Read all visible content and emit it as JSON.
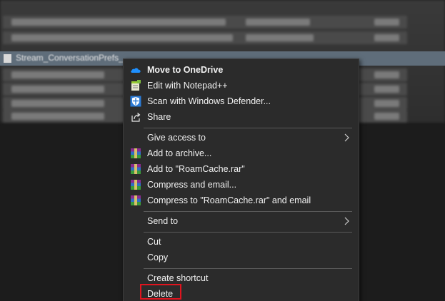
{
  "explorer": {
    "selected_file": "Stream_ConversationPrefs_..."
  },
  "context_menu": {
    "items": [
      {
        "label": "Move to OneDrive",
        "icon": "onedrive-cloud-icon"
      },
      {
        "label": "Edit with Notepad++",
        "icon": "notepad-plus-plus-icon"
      },
      {
        "label": "Scan with Windows Defender...",
        "icon": "windows-defender-shield-icon"
      },
      {
        "label": "Share",
        "icon": "share-icon"
      },
      {
        "label": "Give access to"
      },
      {
        "label": "Add to archive...",
        "icon": "winrar-icon"
      },
      {
        "label": "Add to \"RoamCache.rar\"",
        "icon": "winrar-icon"
      },
      {
        "label": "Compress and email...",
        "icon": "winrar-icon"
      },
      {
        "label": "Compress to \"RoamCache.rar\" and email",
        "icon": "winrar-icon"
      },
      {
        "label": "Send to"
      },
      {
        "label": "Cut"
      },
      {
        "label": "Copy"
      },
      {
        "label": "Create shortcut"
      },
      {
        "label": "Delete"
      }
    ]
  },
  "colors": {
    "menu_background": "#2b2b2b",
    "highlight_border": "#e0141e"
  }
}
